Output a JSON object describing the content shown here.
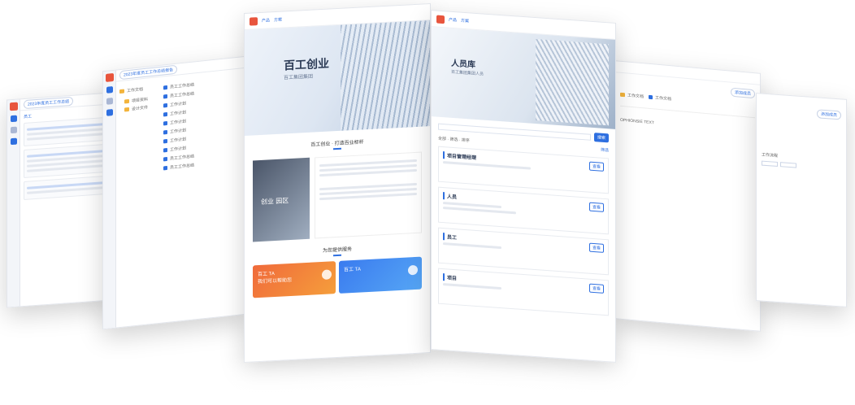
{
  "panel1": {
    "title_tabs": [
      "2023年度员工工作总结"
    ],
    "tab_label": "员工"
  },
  "panel2": {
    "header": "2023年度员工工作总结报告",
    "folders": [
      "工作文档",
      "项目资料",
      "设计文件"
    ],
    "files": [
      "员工工作总结",
      "员工工作总结",
      "工作计划",
      "工作计划",
      "工作计划",
      "工作计划",
      "工作计划",
      "工作计划",
      "员工工作总结",
      "员工工作总结"
    ]
  },
  "panel3": {
    "nav": [
      "产品",
      "方案"
    ],
    "hero_title": "百工创业",
    "hero_sub": "百工集团集团",
    "section1": "百工创业 · 打造百业标杆",
    "feature_img_text": "创业 园区",
    "section2": "为您提供服务",
    "cta1": "百工 TA",
    "cta1_sub": "我们可以帮助您",
    "cta2": "百工 TA"
  },
  "panel4": {
    "nav": [
      "产品",
      "方案"
    ],
    "hero_title": "人员库",
    "hero_sub": "百工集团集团人员",
    "search_btn": "搜索",
    "filter_label": "全部 · 筛选 · 排序",
    "filter_link": "筛选",
    "items": [
      {
        "title": "项目管理经理",
        "btn": "查看"
      },
      {
        "title": "人员",
        "btn": "查看"
      },
      {
        "title": "员工",
        "btn": "查看"
      },
      {
        "title": "项目",
        "btn": "查看"
      }
    ]
  },
  "panel5": {
    "chips": [
      "工作文档",
      "工作文档"
    ],
    "badge": "添加成员",
    "body_text": "OPHIONSIE TEXT"
  },
  "panel6": {
    "badge": "添加成员",
    "head": "工作流程"
  }
}
